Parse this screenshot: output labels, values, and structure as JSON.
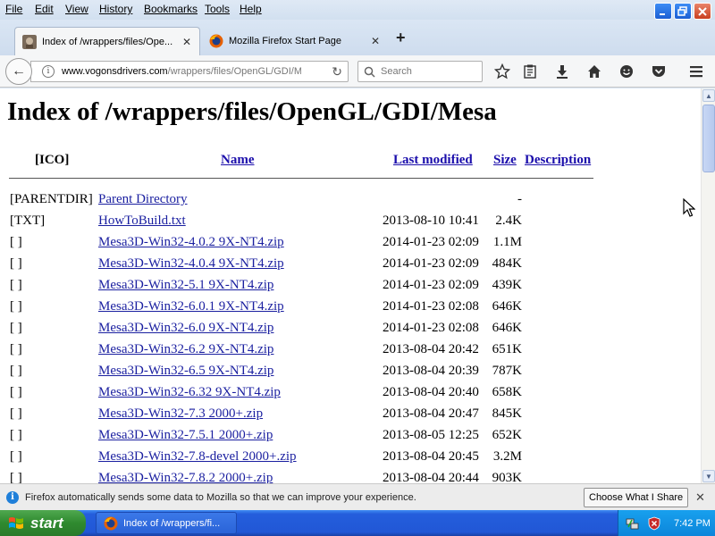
{
  "menu": [
    {
      "name": "file",
      "label": "File"
    },
    {
      "name": "edit",
      "label": "Edit"
    },
    {
      "name": "view",
      "label": "View"
    },
    {
      "name": "history",
      "label": "History"
    },
    {
      "name": "bookmarks",
      "label": "Bookmarks"
    },
    {
      "name": "tools",
      "label": "Tools"
    },
    {
      "name": "help",
      "label": "Help"
    }
  ],
  "window_controls": {
    "minimize": "minimize-icon",
    "maximize": "maximize-icon",
    "close": "close-icon"
  },
  "tabs": [
    {
      "label": "Index of /wrappers/files/Ope...",
      "icon": "site-favicon",
      "active": true
    },
    {
      "label": "Mozilla Firefox Start Page",
      "icon": "firefox-icon",
      "active": false
    }
  ],
  "newtab_label": "+",
  "nav": {
    "url_domain": "www.vogonsdrivers.com",
    "url_path": "/wrappers/files/OpenGL/GDI/M",
    "search_placeholder": "Search"
  },
  "page": {
    "heading": "Index of /wrappers/files/OpenGL/GDI/Mesa",
    "columns": {
      "icon": "[ICO]",
      "name": "Name",
      "modified": "Last modified",
      "size": "Size",
      "description": "Description"
    },
    "rows": [
      {
        "icon": "[PARENTDIR]",
        "name": "Parent Directory",
        "modified": "",
        "size": "-"
      },
      {
        "icon": "[TXT]",
        "name": "HowToBuild.txt",
        "modified": "2013-08-10 10:41",
        "size": "2.4K"
      },
      {
        "icon": "[ ]",
        "name": "Mesa3D-Win32-4.0.2 9X-NT4.zip",
        "modified": "2014-01-23 02:09",
        "size": "1.1M"
      },
      {
        "icon": "[ ]",
        "name": "Mesa3D-Win32-4.0.4 9X-NT4.zip",
        "modified": "2014-01-23 02:09",
        "size": "484K"
      },
      {
        "icon": "[ ]",
        "name": "Mesa3D-Win32-5.1 9X-NT4.zip",
        "modified": "2014-01-23 02:09",
        "size": "439K"
      },
      {
        "icon": "[ ]",
        "name": "Mesa3D-Win32-6.0.1 9X-NT4.zip",
        "modified": "2014-01-23 02:08",
        "size": "646K"
      },
      {
        "icon": "[ ]",
        "name": "Mesa3D-Win32-6.0 9X-NT4.zip",
        "modified": "2014-01-23 02:08",
        "size": "646K"
      },
      {
        "icon": "[ ]",
        "name": "Mesa3D-Win32-6.2 9X-NT4.zip",
        "modified": "2013-08-04 20:42",
        "size": "651K"
      },
      {
        "icon": "[ ]",
        "name": "Mesa3D-Win32-6.5 9X-NT4.zip",
        "modified": "2013-08-04 20:39",
        "size": "787K"
      },
      {
        "icon": "[ ]",
        "name": "Mesa3D-Win32-6.32 9X-NT4.zip",
        "modified": "2013-08-04 20:40",
        "size": "658K"
      },
      {
        "icon": "[ ]",
        "name": "Mesa3D-Win32-7.3 2000+.zip",
        "modified": "2013-08-04 20:47",
        "size": "845K"
      },
      {
        "icon": "[ ]",
        "name": "Mesa3D-Win32-7.5.1 2000+.zip",
        "modified": "2013-08-05 12:25",
        "size": "652K"
      },
      {
        "icon": "[ ]",
        "name": "Mesa3D-Win32-7.8-devel 2000+.zip",
        "modified": "2013-08-04 20:45",
        "size": "3.2M"
      },
      {
        "icon": "[ ]",
        "name": "Mesa3D-Win32-7.8.2 2000+.zip",
        "modified": "2013-08-04 20:44",
        "size": "903K"
      }
    ]
  },
  "notification": {
    "text": "Firefox automatically sends some data to Mozilla so that we can improve your experience.",
    "button": "Choose What I Share"
  },
  "taskbar": {
    "start_label": "start",
    "window_label": "Index of /wrappers/fi...",
    "time": "7:42 PM"
  },
  "colors": {
    "link": "#1a1fa0",
    "taskbar": "#245edc",
    "start": "#2f8a2f"
  }
}
